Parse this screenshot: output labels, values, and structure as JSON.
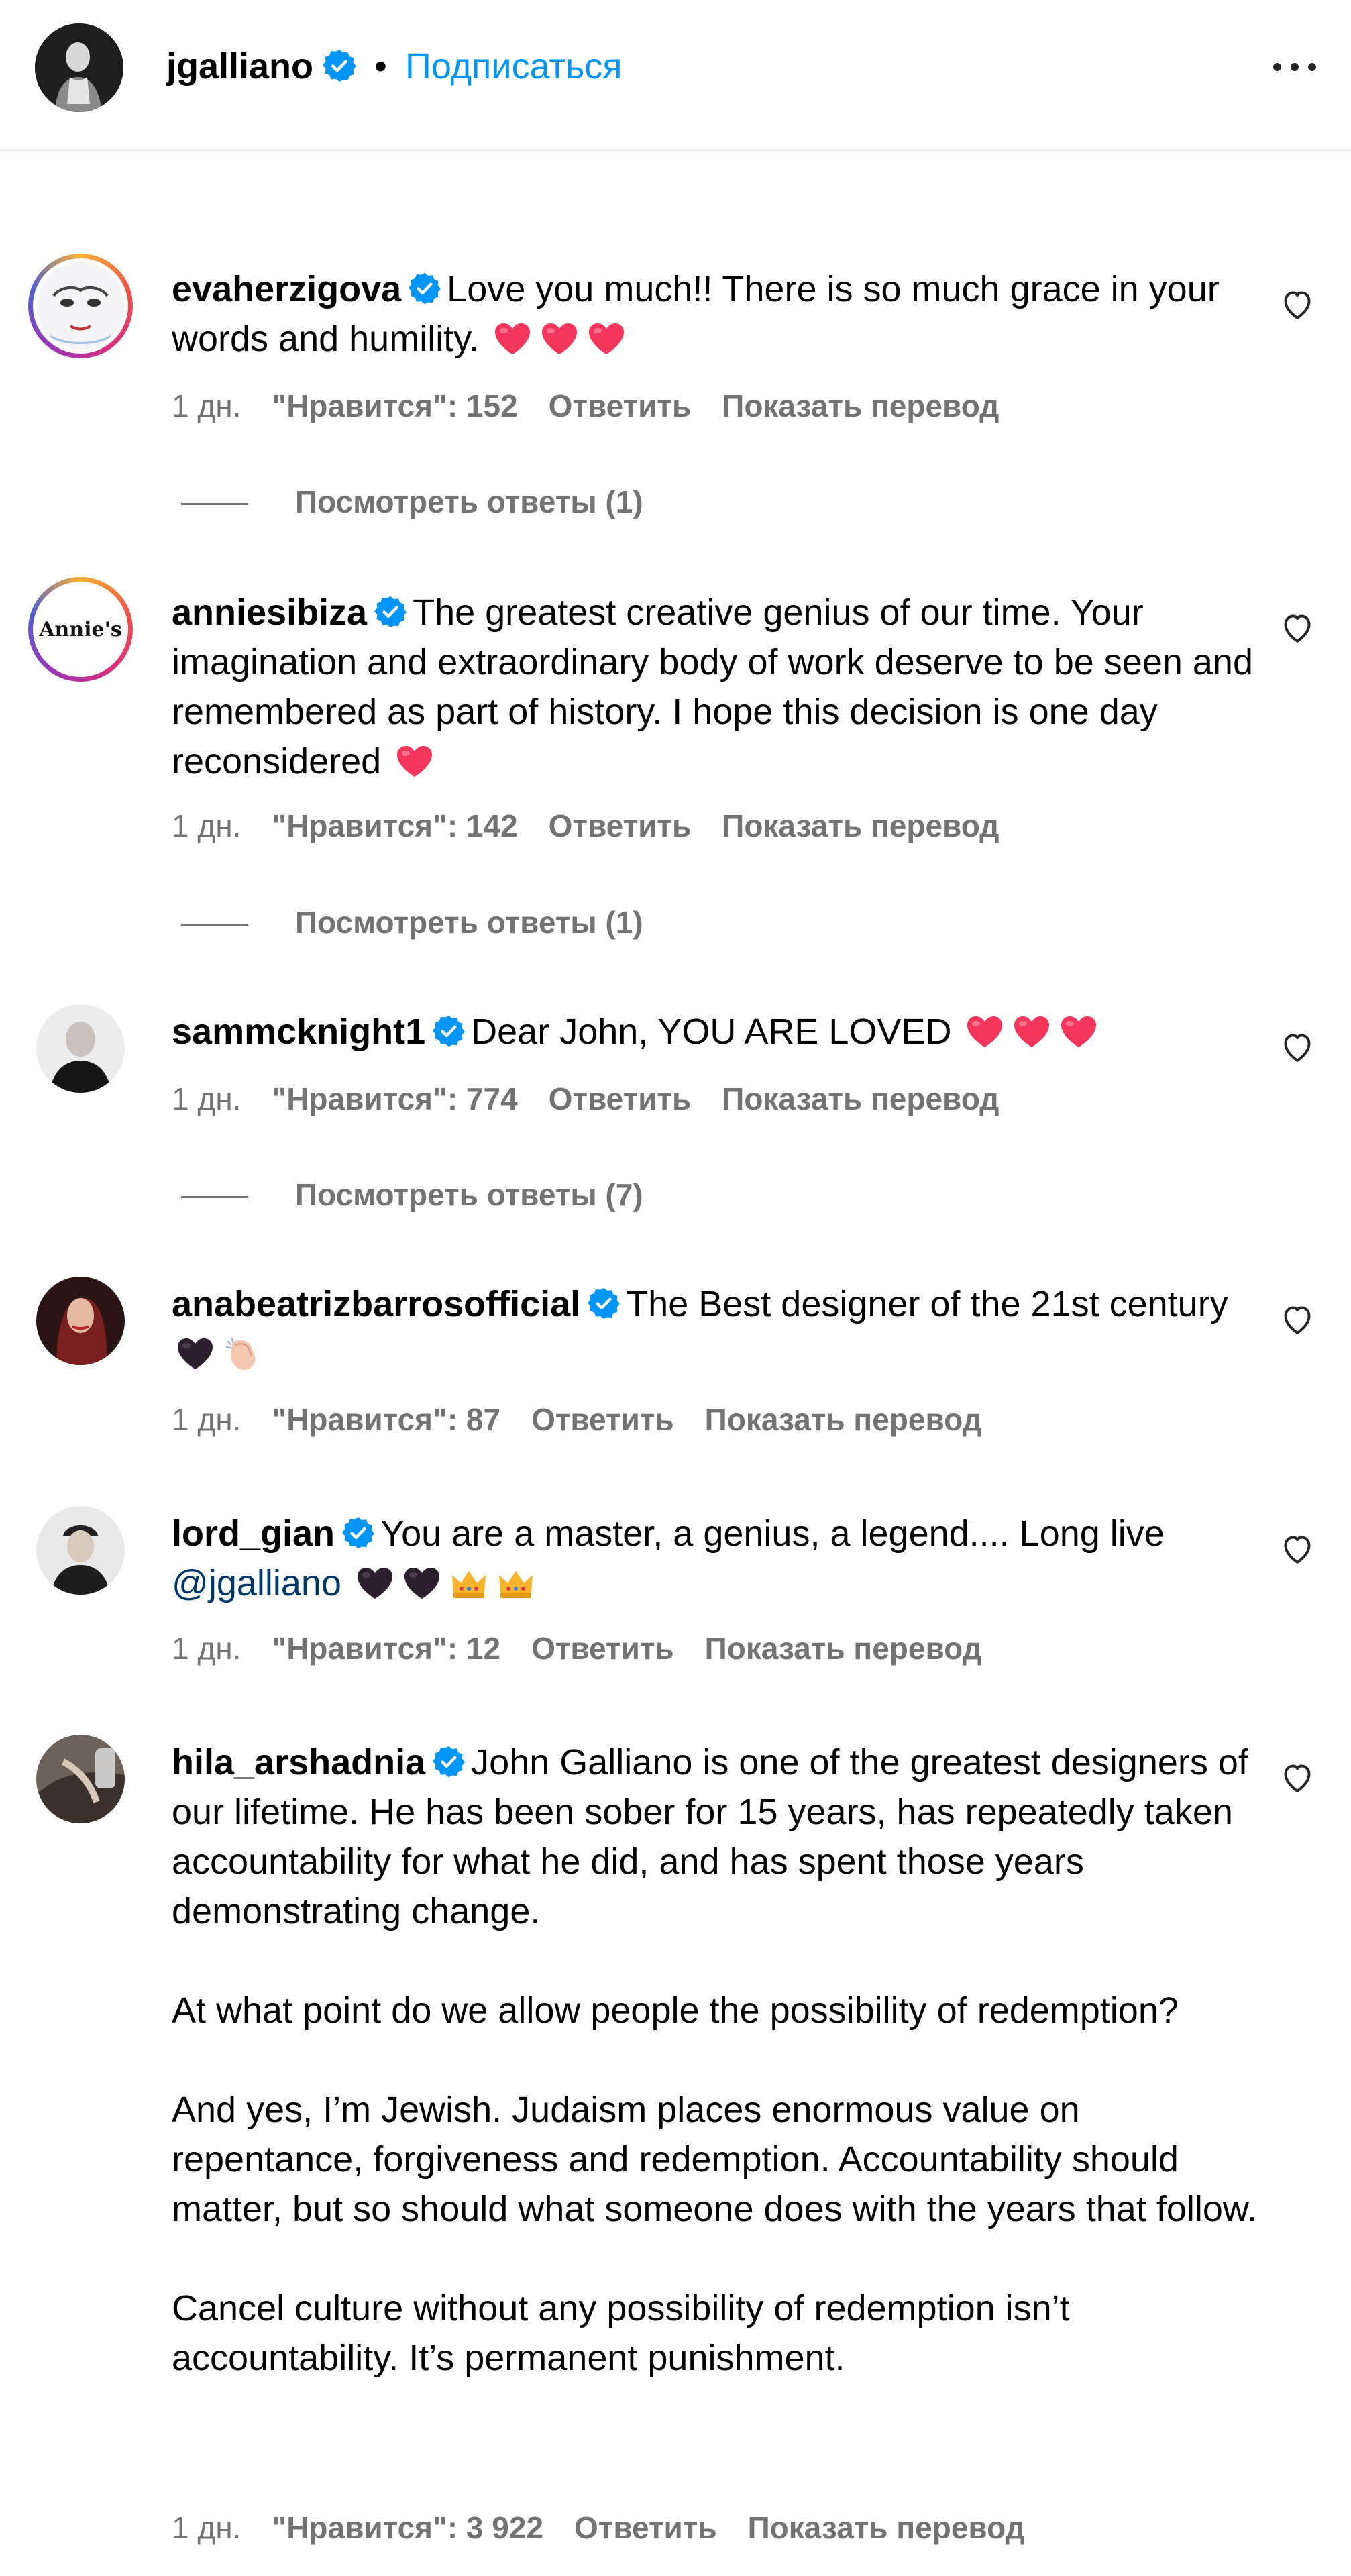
{
  "header": {
    "username": "jgalliano",
    "separator": "•",
    "follow_label": "Подписаться",
    "more_icon": "more-horizontal-icon"
  },
  "colors": {
    "link_blue": "#0095f6",
    "verified_blue": "#0095f6",
    "meta_gray": "#737373",
    "heart_red": "#f5365c",
    "mention": "#00376b"
  },
  "comments": [
    {
      "username": "evaherzigova",
      "text": "Love you much!! There is so much grace in your words and humility.",
      "emojis": [
        "red-heart",
        "red-heart",
        "red-heart"
      ],
      "time": "1 дн.",
      "likes": "\"Нравится\": 152",
      "reply": "Ответить",
      "translate": "Показать перевод",
      "view_replies": "Посмотреть ответы (1)"
    },
    {
      "username": "anniesibiza",
      "avatar_text": "Annie's",
      "text": "The greatest creative genius of our time. Your imagination and extraordinary body of work deserve to be seen and remembered as part of history. I hope this decision is one day reconsidered",
      "emojis": [
        "red-heart"
      ],
      "time": "1 дн.",
      "likes": "\"Нравится\": 142",
      "reply": "Ответить",
      "translate": "Показать перевод",
      "view_replies": "Посмотреть ответы (1)"
    },
    {
      "username": "sammcknight1",
      "text": "Dear John, YOU ARE LOVED",
      "emojis": [
        "red-heart",
        "red-heart",
        "red-heart"
      ],
      "time": "1 дн.",
      "likes": "\"Нравится\": 774",
      "reply": "Ответить",
      "translate": "Показать перевод",
      "view_replies": "Посмотреть ответы (7)"
    },
    {
      "username": "anabeatrizbarrosofficial",
      "text": "The Best designer of the 21st century",
      "emojis": [
        "black-heart",
        "clapping-hands"
      ],
      "time": "1 дн.",
      "likes": "\"Нравится\": 87",
      "reply": "Ответить",
      "translate": "Показать перевод"
    },
    {
      "username": "lord_gian",
      "text": "You are a master, a genius, a legend.... Long live",
      "mention": "@jgalliano",
      "emojis": [
        "black-heart",
        "black-heart",
        "crown",
        "crown"
      ],
      "time": "1 дн.",
      "likes": "\"Нравится\": 12",
      "reply": "Ответить",
      "translate": "Показать перевод"
    },
    {
      "username": "hila_arshadnia",
      "text": "John Galliano is one of the greatest designers of our lifetime. He has been sober for 15 years, has repeatedly taken accountability for what he did, and has spent those years demonstrating change.",
      "paragraphs": [
        "At what point do we allow people the possibility of redemption?",
        "And yes, I’m Jewish. Judaism places enormous value on repentance, forgiveness and redemption. Accountability should matter, but so should what someone does with the years that follow.",
        "Cancel culture without any possibility of redemption isn’t accountability. It’s permanent punishment."
      ],
      "time": "1 дн.",
      "likes": "\"Нравится\": 3 922",
      "reply": "Ответить",
      "translate": "Показать перевод"
    }
  ]
}
